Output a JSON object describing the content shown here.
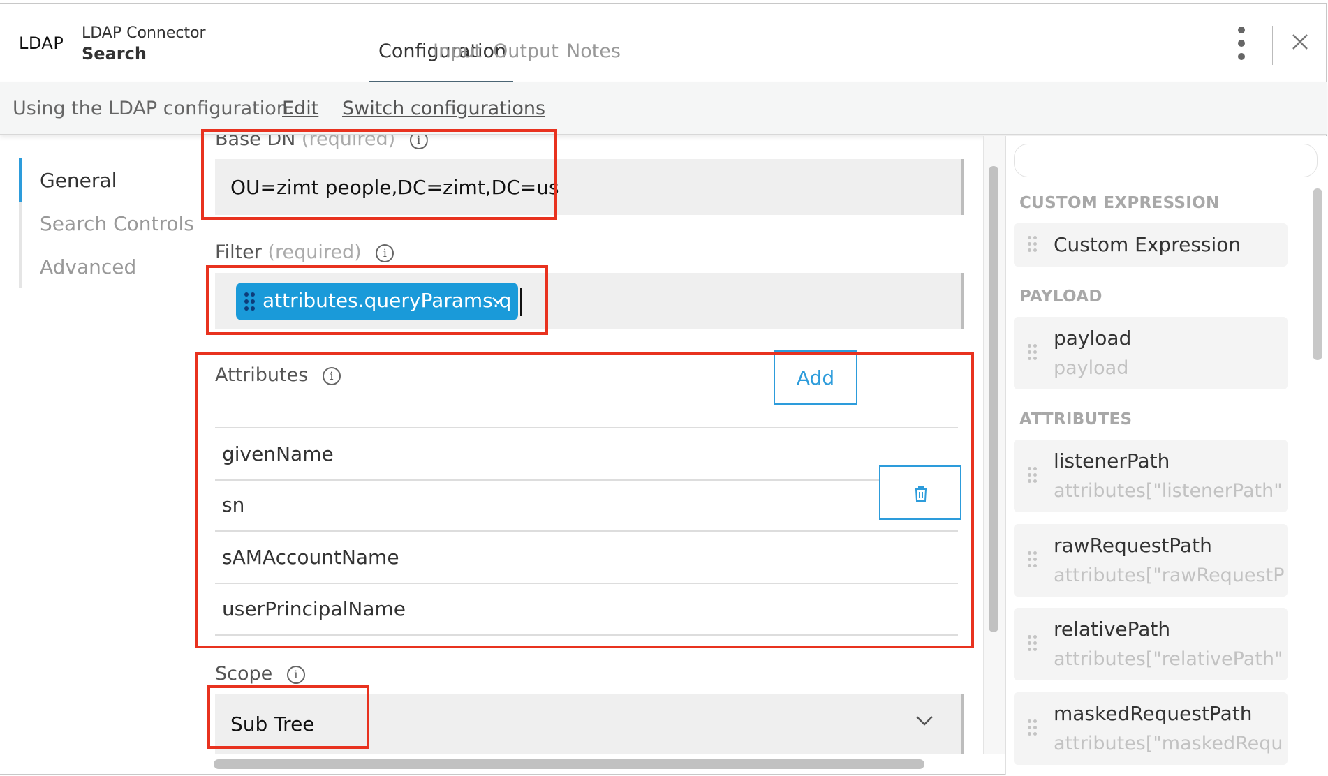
{
  "header": {
    "logo": "LDAP",
    "connector_name": "LDAP Connector",
    "operation": "Search",
    "tabs": [
      "Configuration",
      "Input",
      "Output",
      "Notes"
    ],
    "active_tab": "Configuration"
  },
  "config_bar": {
    "text": "Using the LDAP configuration.",
    "edit_link": "Edit",
    "switch_link": "Switch configurations"
  },
  "nav": {
    "items": [
      "General",
      "Search Controls",
      "Advanced"
    ],
    "active": "General"
  },
  "form": {
    "base_dn": {
      "label": "Base DN",
      "required": "(required)",
      "value": "OU=zimt people,DC=zimt,DC=us"
    },
    "filter": {
      "label": "Filter",
      "required": "(required)",
      "pill": "attributes.queryParams.q"
    },
    "attributes": {
      "label": "Attributes",
      "add_label": "Add",
      "items": [
        "givenName",
        "sn",
        "sAMAccountName",
        "userPrincipalName"
      ]
    },
    "scope": {
      "label": "Scope",
      "value": "Sub Tree"
    }
  },
  "right_panel": {
    "search_placeholder": "",
    "sections": [
      {
        "title": "CUSTOM EXPRESSION",
        "cards": [
          {
            "title": "Custom Expression",
            "sub": ""
          }
        ]
      },
      {
        "title": "PAYLOAD",
        "cards": [
          {
            "title": "payload",
            "sub": "payload"
          }
        ]
      },
      {
        "title": "ATTRIBUTES",
        "cards": [
          {
            "title": "listenerPath",
            "sub": "attributes[\"listenerPath\"]"
          },
          {
            "title": "rawRequestPath",
            "sub": "attributes[\"rawRequestPa…"
          },
          {
            "title": "relativePath",
            "sub": "attributes[\"relativePath\"]"
          },
          {
            "title": "maskedRequestPath",
            "sub": "attributes[\"maskedReque…"
          }
        ]
      }
    ]
  },
  "colors": {
    "accent": "#2d9cdb",
    "pill": "#1a9ad9",
    "highlight": "#e8321f",
    "tab_indicator": "#4c6675"
  }
}
